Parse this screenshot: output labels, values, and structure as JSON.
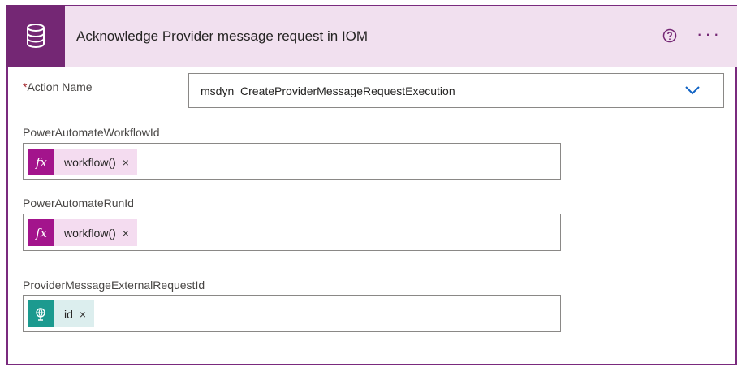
{
  "header": {
    "title": "Acknowledge Provider message request in IOM",
    "icon": "database-icon",
    "help_icon": "help-icon",
    "more_icon": "more-options-icon",
    "more_symbol": "···",
    "color": "#742774",
    "background": "#f1e0ef"
  },
  "action_name": {
    "required_mark": "*",
    "label": "Action Name",
    "value": "msdyn_CreateProviderMessageRequestExecution",
    "dropdown_icon": "chevron-down-icon"
  },
  "fields": [
    {
      "label": "PowerAutomateWorkflowId",
      "token": {
        "icon": "fx-icon",
        "icon_text": "fx",
        "text": "workflow()",
        "remove": "×",
        "color": "#a3148c",
        "bg": "#f4dcf0"
      }
    },
    {
      "label": "PowerAutomateRunId",
      "token": {
        "icon": "fx-icon",
        "icon_text": "fx",
        "text": "workflow()",
        "remove": "×",
        "color": "#a3148c",
        "bg": "#f4dcf0"
      }
    },
    {
      "label": "ProviderMessageExternalRequestId",
      "token": {
        "icon": "http-globe-icon",
        "icon_text": "",
        "text": "id",
        "remove": "×",
        "color": "#1c9a8f",
        "bg": "#dceeee"
      }
    }
  ]
}
